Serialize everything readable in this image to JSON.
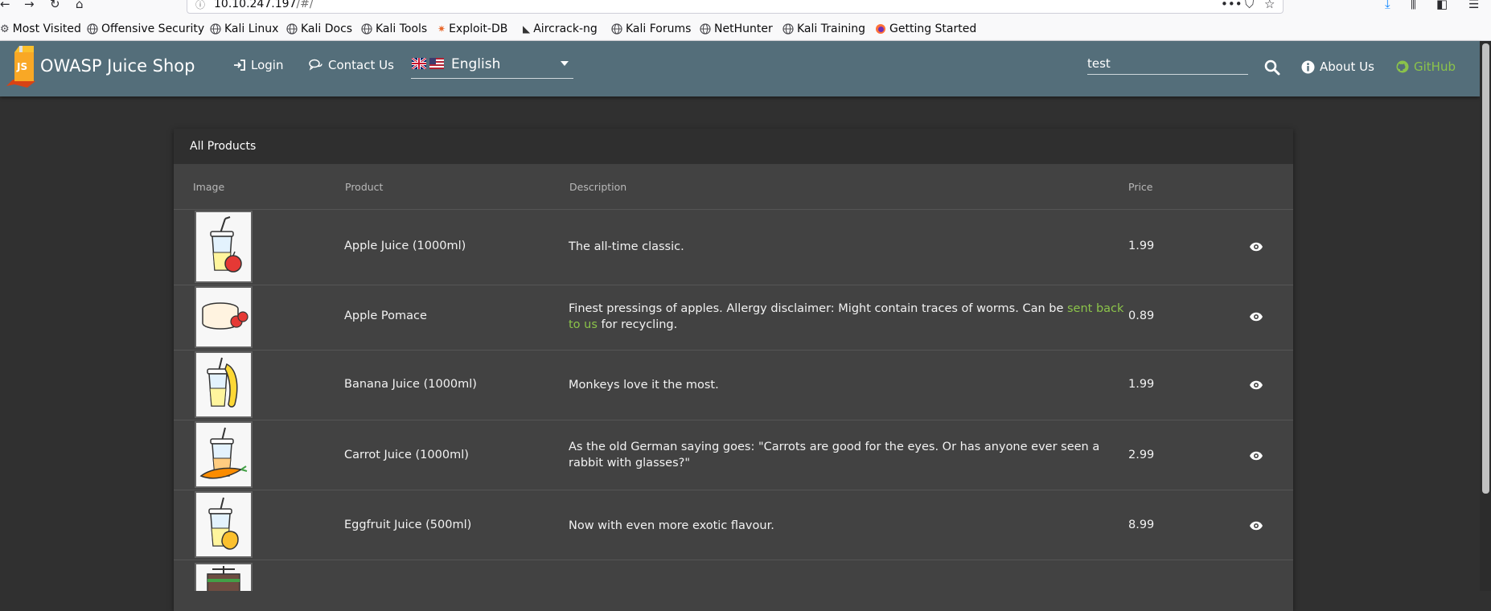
{
  "browser": {
    "url_host": "10.10.247.197",
    "url_path": "/#/",
    "bookmarks": [
      {
        "label": "Most Visited",
        "icon": "gear-icon"
      },
      {
        "label": "Offensive Security",
        "icon": "globe-icon"
      },
      {
        "label": "Kali Linux",
        "icon": "globe-icon"
      },
      {
        "label": "Kali Docs",
        "icon": "globe-icon"
      },
      {
        "label": "Kali Tools",
        "icon": "globe-icon"
      },
      {
        "label": "Exploit-DB",
        "icon": "exploitdb-icon"
      },
      {
        "label": "Aircrack-ng",
        "icon": "aircrack-icon"
      },
      {
        "label": "Kali Forums",
        "icon": "globe-icon"
      },
      {
        "label": "NetHunter",
        "icon": "globe-icon"
      },
      {
        "label": "Kali Training",
        "icon": "globe-icon"
      },
      {
        "label": "Getting Started",
        "icon": "firefox-icon"
      }
    ]
  },
  "header": {
    "title": "OWASP Juice Shop",
    "login_label": "Login",
    "contact_label": "Contact Us",
    "language": "English",
    "search_value": "test",
    "about_label": "About Us",
    "github_label": "GitHub",
    "colors": {
      "toolbar": "#546e7a",
      "github": "#8bc34a"
    }
  },
  "products": {
    "title": "All Products",
    "columns": [
      "Image",
      "Product",
      "Description",
      "Price"
    ],
    "rows": [
      {
        "name": "Apple Juice (1000ml)",
        "description": "The all-time classic.",
        "price": "1.99"
      },
      {
        "name": "Apple Pomace",
        "description_before": "Finest pressings of apples. Allergy disclaimer: Might contain traces of worms. Can be ",
        "description_link": "sent back to us",
        "description_after": " for recycling.",
        "price": "0.89"
      },
      {
        "name": "Banana Juice (1000ml)",
        "description": "Monkeys love it the most.",
        "price": "1.99"
      },
      {
        "name": "Carrot Juice (1000ml)",
        "description": "As the old German saying goes: \"Carrots are good for the eyes. Or has anyone ever seen a rabbit with glasses?\"",
        "price": "2.99"
      },
      {
        "name": "Eggfruit Juice (500ml)",
        "description": "Now with even more exotic flavour.",
        "price": "8.99"
      }
    ]
  }
}
